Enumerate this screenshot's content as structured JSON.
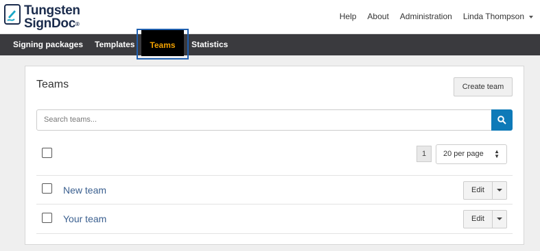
{
  "header": {
    "brand_line1": "Tungsten",
    "brand_line2": "SignDoc",
    "brand_reg": "®",
    "nav": [
      "Help",
      "About",
      "Administration",
      "Linda Thompson"
    ]
  },
  "navbar": {
    "items": [
      "Signing packages",
      "Templates",
      "Teams",
      "Statistics"
    ],
    "active": "Teams",
    "active_color": "#f0a000"
  },
  "main": {
    "title": "Teams",
    "create_button": "Create team",
    "search_placeholder": "Search teams...",
    "page_number": "1",
    "per_page": "20 per page",
    "rows": [
      {
        "name": "New team",
        "action": "Edit"
      },
      {
        "name": "Your team",
        "action": "Edit"
      }
    ]
  },
  "icons": [
    "logo-pen-icon",
    "search-icon",
    "user-caret-icon",
    "select-arrows-icon",
    "edit-caret-icon"
  ],
  "colors": {
    "brand": "#1a2b4c",
    "accent": "#0e7ab8",
    "nav_bg": "#3a3a3e",
    "link": "#3a5f8f"
  }
}
